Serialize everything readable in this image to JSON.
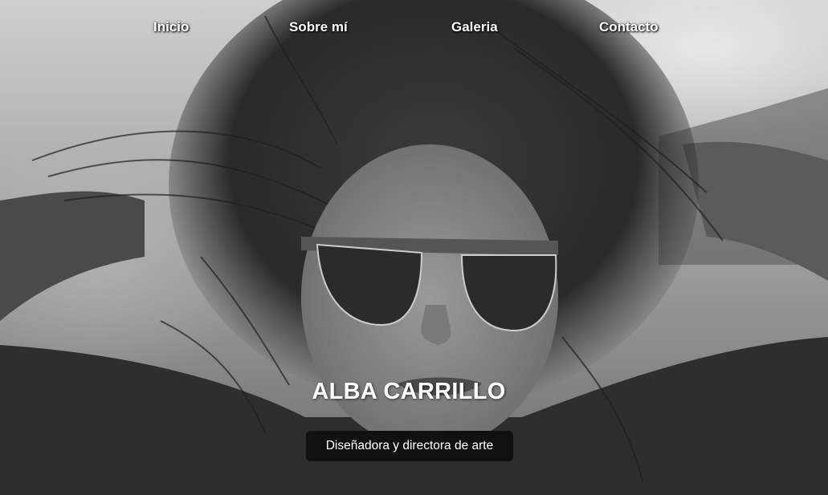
{
  "nav": {
    "items": [
      {
        "label": "Inicio"
      },
      {
        "label": "Sobre mí"
      },
      {
        "label": "Galeria"
      },
      {
        "label": "Contacto"
      }
    ]
  },
  "hero": {
    "image_icon": "portrait-photo",
    "title": "ALBA CARRILLO",
    "subtitle": "Diseñadora y directora de arte"
  },
  "colors": {
    "text": "#ffffff",
    "pill_background": "#111111"
  }
}
